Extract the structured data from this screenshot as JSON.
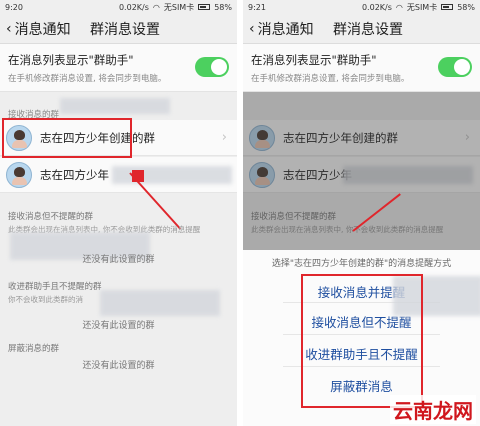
{
  "left": {
    "status": {
      "time": "9:20",
      "speed": "0.02K/s",
      "carrier": "无SIM卡",
      "battery": "58%"
    },
    "header": {
      "back_label": "消息通知",
      "title": "群消息设置"
    },
    "setting": {
      "label": "在消息列表显示\"群助手\"",
      "sub": "在手机修改群消息设置, 将会同步到电脑。"
    },
    "section_receive": "接收消息的群",
    "groups": [
      {
        "name": "志在四方少年创建的群"
      },
      {
        "name": "志在四方少年"
      }
    ],
    "no_remind": {
      "label": "接收消息但不提醒的群",
      "sub": "此类群会出现在消息列表中, 你不会收到此类群的消息提醒"
    },
    "helper": {
      "label": "收进群助手且不提醒的群",
      "sub": "你不会收到此类群的消"
    },
    "blocked": {
      "label": "屏蔽消息的群"
    },
    "empty_text": "还没有此设置的群"
  },
  "right": {
    "status": {
      "time": "9:21",
      "speed": "0.02K/s",
      "carrier": "无SIM卡",
      "battery": "58%"
    },
    "header": {
      "back_label": "消息通知",
      "title": "群消息设置"
    },
    "setting": {
      "label": "在消息列表显示\"群助手\"",
      "sub": "在手机修改群消息设置, 将会同步到电脑。"
    },
    "groups": [
      {
        "name": "志在四方少年创建的群"
      },
      {
        "name": "志在四方少年"
      }
    ],
    "no_remind": {
      "label": "接收消息但不提醒的群",
      "sub": "此类群会出现在消息列表中, 你不会收到此类群的消息提醒"
    },
    "sheet": {
      "title": "选择\"志在四方少年创建的群\"的消息提醒方式",
      "options": [
        "接收消息并提醒",
        "接收消息但不提醒",
        "收进群助手且不提醒",
        "屏蔽群消息"
      ]
    }
  },
  "watermark": "云南龙网",
  "colors": {
    "highlight": "#e0262c",
    "toggle_on": "#4cd05f",
    "option_text": "#1f4fa0"
  }
}
